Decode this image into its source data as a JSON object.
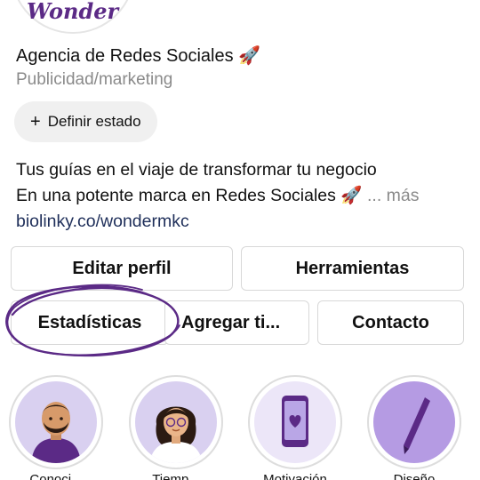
{
  "profile": {
    "logo_text": "Wonder",
    "name": "Agencia de Redes Sociales 🚀",
    "category": "Publicidad/marketing",
    "status_button": "Definir estado",
    "bio_line1": "Tus guías en el viaje de transformar tu negocio",
    "bio_line2": "En una potente marca en Redes Sociales 🚀",
    "bio_more": "... más",
    "link": "biolinky.co/wondermkc"
  },
  "buttons": {
    "edit_profile": "Editar perfil",
    "tools": "Herramientas",
    "stats": "Estadísticas",
    "add": "Agregar ti...",
    "contact": "Contacto"
  },
  "highlights": [
    {
      "label": "Conoci...",
      "icon": "man-avatar-icon"
    },
    {
      "label": "Tiemp...",
      "icon": "woman-avatar-icon"
    },
    {
      "label": "Motivación",
      "icon": "phone-heart-icon"
    },
    {
      "label": "Diseño",
      "icon": "pencil-icon"
    }
  ],
  "colors": {
    "brand_purple": "#5b2a86",
    "highlight_bg": "#d9d0f0",
    "muted_text": "#8a8a8a"
  }
}
